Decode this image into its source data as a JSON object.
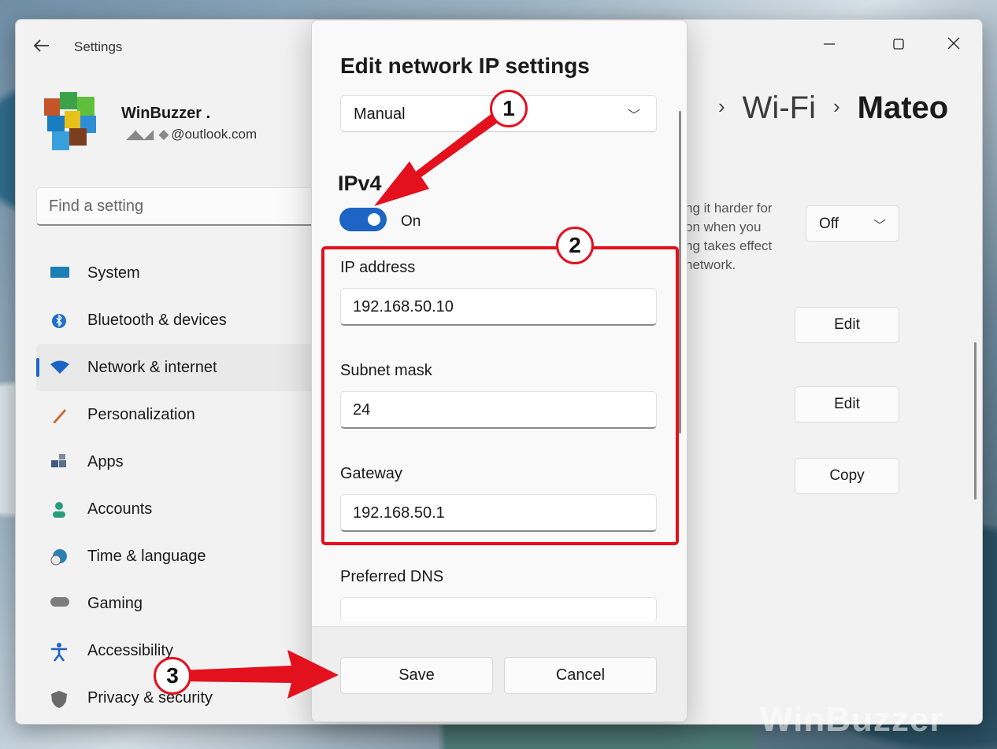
{
  "window": {
    "title": "Settings",
    "back_icon": "arrow-left-icon",
    "controls": {
      "minimize": "—",
      "maximize": "☐",
      "close": "✕"
    }
  },
  "profile": {
    "name": "WinBuzzer .",
    "email": "@outlook.com"
  },
  "search": {
    "placeholder": "Find a setting"
  },
  "nav": {
    "items": [
      {
        "label": "System",
        "icon": "monitor-icon",
        "color": "#1b7fb5",
        "selected": false
      },
      {
        "label": "Bluetooth & devices",
        "icon": "bluetooth-icon",
        "color": "#1d6fc9",
        "selected": false
      },
      {
        "label": "Network & internet",
        "icon": "wifi-icon",
        "color": "#1d64c4",
        "selected": true
      },
      {
        "label": "Personalization",
        "icon": "brush-icon",
        "color": "#c96a2a",
        "selected": false
      },
      {
        "label": "Apps",
        "icon": "apps-icon",
        "color": "#3d5a80",
        "selected": false
      },
      {
        "label": "Accounts",
        "icon": "person-icon",
        "color": "#2a9d7b",
        "selected": false
      },
      {
        "label": "Time & language",
        "icon": "clock-globe-icon",
        "color": "#2a7fb5",
        "selected": false
      },
      {
        "label": "Gaming",
        "icon": "gamepad-icon",
        "color": "#7d7d7d",
        "selected": false
      },
      {
        "label": "Accessibility",
        "icon": "accessibility-icon",
        "color": "#1d64c4",
        "selected": false
      },
      {
        "label": "Privacy & security",
        "icon": "shield-icon",
        "color": "#6b6b6b",
        "selected": false
      }
    ]
  },
  "breadcrumb": {
    "mid": "Wi-Fi",
    "current": "Mateo"
  },
  "background_panel": {
    "text_lines": [
      "ng it harder for",
      "on when you",
      "ng takes effect",
      "network."
    ],
    "random_hw_value": "Off",
    "buttons": [
      "Edit",
      "Edit",
      "Copy"
    ]
  },
  "dialog": {
    "title": "Edit network IP settings",
    "mode": "Manual",
    "ipv4_heading": "IPv4",
    "ipv4_toggle": "On",
    "fields": {
      "ip_label": "IP address",
      "ip_value": "192.168.50.10",
      "subnet_label": "Subnet mask",
      "subnet_value": "24",
      "gateway_label": "Gateway",
      "gateway_value": "192.168.50.1",
      "dns_label": "Preferred DNS"
    },
    "save": "Save",
    "cancel": "Cancel"
  },
  "annotations": {
    "badge1": "1",
    "badge2": "2",
    "badge3": "3",
    "color": "#e3101e"
  },
  "watermark": "WinBuzzer"
}
